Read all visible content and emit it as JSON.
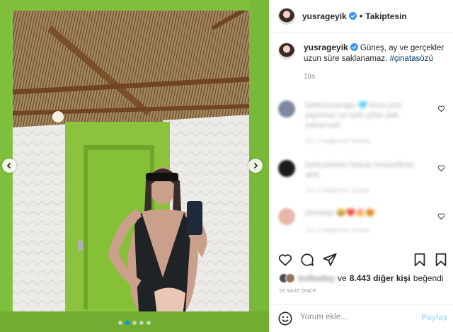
{
  "post": {
    "username": "yusrageyik",
    "follow_status": "Takiptesin",
    "separator": "•",
    "caption": {
      "username": "yusrageyik",
      "text": "Güneş, ay ve gerçekler uzun süre saklanamaz. ",
      "hashtag": "#çinatasözü",
      "time": "18s"
    },
    "carousel": {
      "total_slides": 5,
      "active_slide": 2
    },
    "comments": [
      {
        "text": "fatihhcinaroglu 🩵 Ama yine yapılmaz ne öyle çirkin pek yakışmadı",
        "meta": "11s  2 beğenme  Yanıtla",
        "avatar_color": "#7b8aa0"
      },
      {
        "text": "berkzebetes hiçkaç herşeyliksiz akla",
        "meta": "11s  1 beğenme  Yanıtla",
        "avatar_color": "#1a1a1a"
      },
      {
        "text": "yhnatajs 😂❤️🔥😍",
        "meta": "11s  3 beğenme  Yanıtla",
        "avatar_color": "#e8b7a8"
      }
    ],
    "likes": {
      "liker": "bulkaday",
      "connector": "ve",
      "count_text": "8.443 diğer kişi",
      "suffix": "beğendi"
    },
    "posted_ago": "18 SAAT ÖNCE",
    "comment_input": {
      "placeholder": "Yorum ekle...",
      "value": ""
    },
    "share_label": "Paylaş"
  },
  "colors": {
    "accent": "#0095f6",
    "share_disabled": "#b2dffc",
    "hashtag": "#00376b",
    "verified": "#3897f0"
  },
  "icons": [
    "chevron-left-icon",
    "chevron-right-icon",
    "verified-icon",
    "heart-icon",
    "comment-icon",
    "share-icon",
    "bookmark-icon",
    "emoji-icon"
  ]
}
